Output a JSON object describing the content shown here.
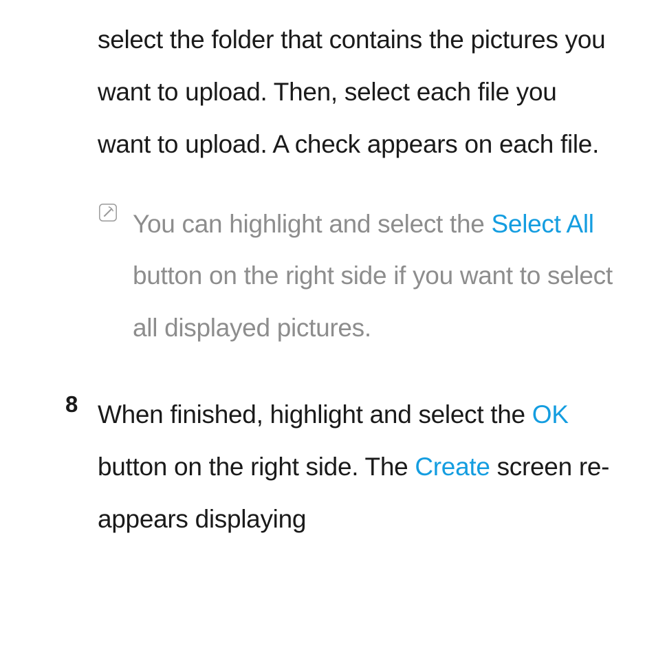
{
  "para1": "select the folder that contains the pictures you want to upload. Then, select each file you want to upload. A check appears on each file.",
  "note": {
    "part1": "You can highlight and select the ",
    "highlight": "Select All",
    "part2": " button on the right side if you want to select all displayed pictures."
  },
  "step": {
    "num": "8",
    "part1": "When finished, highlight and select the ",
    "hl1": "OK",
    "part2": " button on the right side. The ",
    "hl2": "Create",
    "part3": " screen re-appears displaying"
  }
}
